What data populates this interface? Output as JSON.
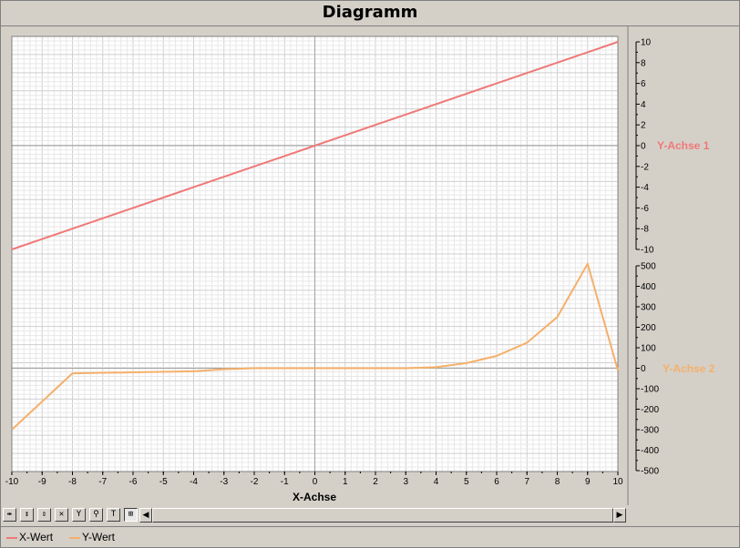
{
  "window": {
    "title": "Diagramm"
  },
  "colors": {
    "series1": "#f07878",
    "series2": "#f5b06a",
    "plot_bg": "#ffffff",
    "grid": "#d9d9d9",
    "axis_zero": "#a0a0a0"
  },
  "toolbar": {
    "buttons": [
      {
        "name": "pan-horizontal-icon",
        "glyph": "⇹"
      },
      {
        "name": "zoom-y-icon",
        "glyph": "↕"
      },
      {
        "name": "fit-y-icon",
        "glyph": "⇕"
      },
      {
        "name": "auto-scale-icon",
        "glyph": "✕"
      },
      {
        "name": "y-axis-icon",
        "glyph": "Y"
      },
      {
        "name": "zoom-icon",
        "glyph": "⚲"
      },
      {
        "name": "text-marker-icon",
        "glyph": "T"
      },
      {
        "name": "table-icon",
        "glyph": "⊞"
      }
    ]
  },
  "legend": {
    "items": [
      "X-Wert",
      "Y-Wert"
    ]
  },
  "chart_data": {
    "type": "line",
    "title": "Diagramm",
    "xlabel": "X-Achse",
    "xlim": [
      -10,
      10
    ],
    "x_ticks": [
      "-10",
      "-9",
      "-8",
      "-7",
      "-6",
      "-5",
      "-4",
      "-3",
      "-2",
      "-1",
      "0",
      "1",
      "2",
      "3",
      "4",
      "5",
      "6",
      "7",
      "8",
      "9",
      "10"
    ],
    "y_axes": [
      {
        "label": "Y-Achse 1",
        "lim": [
          -10,
          10
        ],
        "ticks": [
          "10",
          "8",
          "6",
          "4",
          "2",
          "0",
          "-2",
          "-4",
          "-6",
          "-8",
          "-10"
        ]
      },
      {
        "label": "Y-Achse 2",
        "lim": [
          -500,
          500
        ],
        "ticks": [
          "500",
          "400",
          "300",
          "200",
          "100",
          "0",
          "-100",
          "-200",
          "-300",
          "-400",
          "-500"
        ]
      }
    ],
    "grid": true,
    "legend_position": "bottom-left",
    "series": [
      {
        "name": "X-Wert",
        "axis": 0,
        "x": [
          -10,
          -9,
          -8,
          -7,
          -6,
          -5,
          -4,
          -3,
          -2,
          -1,
          0,
          1,
          2,
          3,
          4,
          5,
          6,
          7,
          8,
          9,
          10
        ],
        "y": [
          -10,
          -9,
          -8,
          -7,
          -6,
          -5,
          -4,
          -3,
          -2,
          -1,
          0,
          1,
          2,
          3,
          4,
          5,
          6,
          7,
          8,
          9,
          10
        ]
      },
      {
        "name": "Y-Wert",
        "axis": 1,
        "x": [
          -10,
          -8,
          -6,
          -4,
          -3,
          -2,
          -1,
          0,
          1,
          2,
          3,
          4,
          5,
          6,
          7,
          8,
          9,
          10
        ],
        "y": [
          -300,
          -25,
          -20,
          -15,
          -5,
          0,
          0,
          0,
          0,
          0,
          0,
          5,
          25,
          60,
          125,
          250,
          510,
          -10
        ]
      }
    ]
  }
}
